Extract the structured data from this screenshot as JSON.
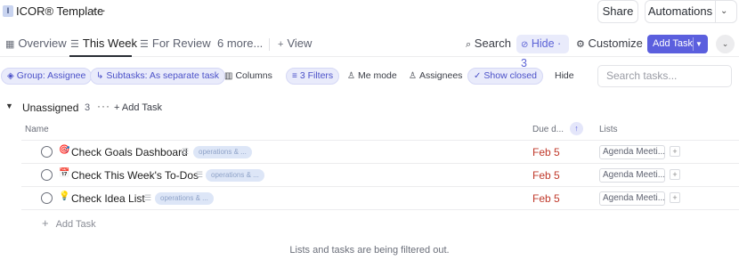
{
  "window": {
    "title": "ICOR® Template",
    "app_icon_letter": "I",
    "share_label": "Share",
    "automations_label": "Automations"
  },
  "views": {
    "tabs": [
      {
        "label": "Overview",
        "icon": "overview-icon"
      },
      {
        "label": "This Week",
        "icon": "list-icon",
        "active": true
      },
      {
        "label": "For Review",
        "icon": "list-icon"
      },
      {
        "label": "6 more...",
        "icon": null
      }
    ],
    "add_view_label": "View",
    "search_label": "Search",
    "hide_label": "Hide · 3",
    "customize_label": "Customize",
    "add_task_label": "Add Task"
  },
  "filters": {
    "group_label": "Group: Assignee",
    "subtasks_label": "Subtasks: As separate task",
    "columns_label": "Columns",
    "filters_label": "3 Filters",
    "me_mode_label": "Me mode",
    "assignees_label": "Assignees",
    "show_closed_label": "Show closed",
    "hide_label": "Hide",
    "search_placeholder": "Search tasks..."
  },
  "group": {
    "name": "Unassigned",
    "count": "3",
    "add_task_label": "Add Task"
  },
  "columns": {
    "name": "Name",
    "due": "Due d...",
    "lists": "Lists"
  },
  "tasks": [
    {
      "emoji": "🎯",
      "name": "Check Goals Dashboard",
      "tag": "operations & ...",
      "due": "Feb 5",
      "list": "Agenda Meeti..."
    },
    {
      "emoji": "📅",
      "name": "Check This Week's To-Dos",
      "tag": "operations & ...",
      "due": "Feb 5",
      "list": "Agenda Meeti..."
    },
    {
      "emoji": "💡",
      "name": "Check Idea List",
      "tag": "operations & ...",
      "due": "Feb 5",
      "list": "Agenda Meeti..."
    }
  ],
  "add_task_row_label": "Add Task",
  "footer_note": "Lists and tasks are being filtered out.",
  "colors": {
    "accent": "#5b5fde",
    "due_red": "#c0392b",
    "tag_bg": "#dde6f7"
  }
}
